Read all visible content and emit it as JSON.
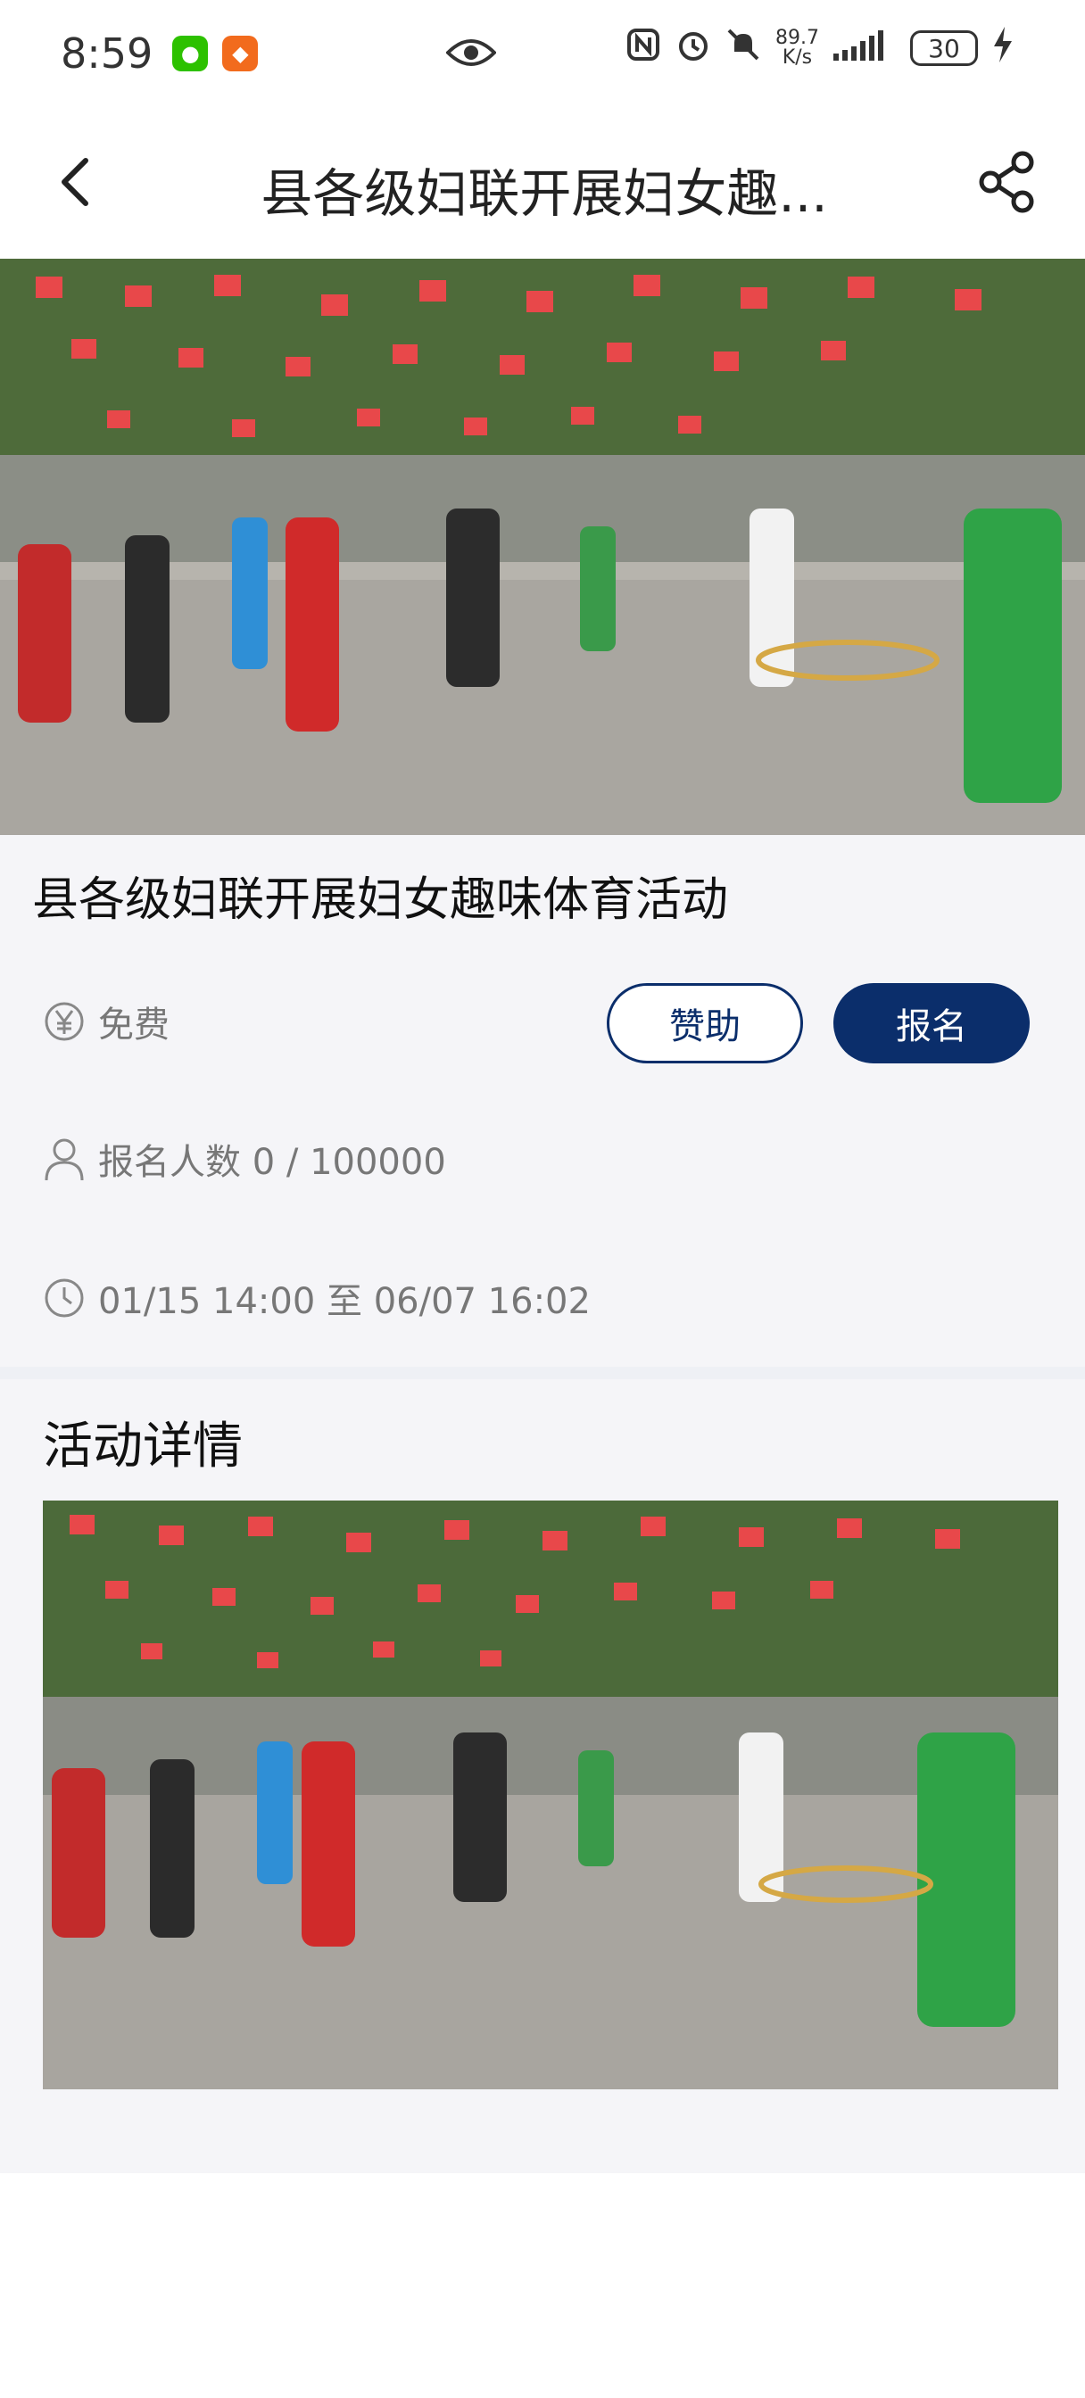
{
  "status_bar": {
    "time": "8:59",
    "net_speed_value": "89.7",
    "net_speed_unit": "K/s",
    "battery": "30"
  },
  "nav": {
    "title": "县各级妇联开展妇女趣...",
    "back_icon": "chevron-left-icon",
    "share_icon": "share-icon"
  },
  "event": {
    "title": "县各级妇联开展妇女趣味体育活动",
    "price": "免费",
    "signup_count": "报名人数 0 / 100000",
    "time_range": "01/15 14:00 至 06/07 16:02",
    "sponsor_label": "赞助",
    "signup_label": "报名"
  },
  "details": {
    "section_title": "活动详情"
  },
  "colors": {
    "primary": "#0b2e6b",
    "background": "#f5f5f8",
    "muted_text": "#777777"
  }
}
